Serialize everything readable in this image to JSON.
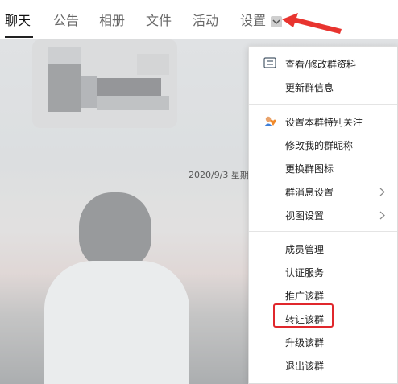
{
  "tabs": [
    {
      "label": "聊天",
      "active": true
    },
    {
      "label": "公告",
      "active": false
    },
    {
      "label": "相册",
      "active": false
    },
    {
      "label": "文件",
      "active": false
    },
    {
      "label": "活动",
      "active": false
    },
    {
      "label": "设置",
      "active": false
    }
  ],
  "chat": {
    "timestamp": "2020/9/3 星期"
  },
  "menu": {
    "group1": [
      {
        "label": "查看/修改群资料",
        "icon": "profile-card-icon"
      },
      {
        "label": "更新群信息",
        "icon": ""
      }
    ],
    "group2": [
      {
        "label": "设置本群特别关注",
        "icon": "special-follow-icon"
      },
      {
        "label": "修改我的群昵称",
        "icon": ""
      },
      {
        "label": "更换群图标",
        "icon": ""
      },
      {
        "label": "群消息设置",
        "icon": "",
        "submenu": true
      },
      {
        "label": "视图设置",
        "icon": "",
        "submenu": true
      }
    ],
    "group3": [
      {
        "label": "成员管理"
      },
      {
        "label": "认证服务"
      },
      {
        "label": "推广该群"
      },
      {
        "label": "转让该群",
        "highlighted": true
      },
      {
        "label": "升级该群"
      },
      {
        "label": "退出该群"
      }
    ]
  },
  "colors": {
    "highlight_border": "#e0272c",
    "arrow": "#e8342f"
  }
}
